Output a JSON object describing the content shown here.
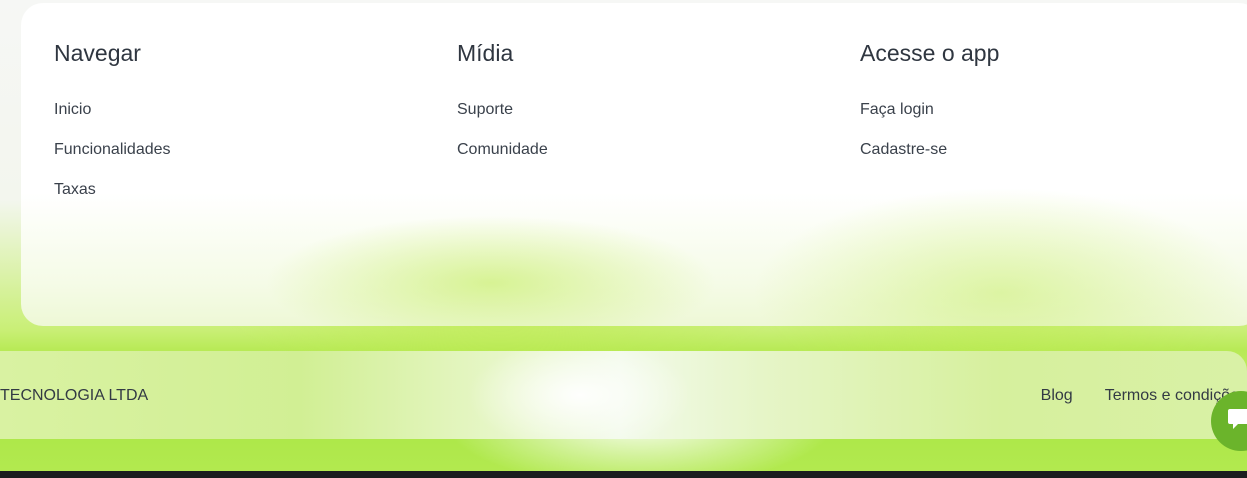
{
  "footer": {
    "columns": [
      {
        "title": "Navegar",
        "links": [
          "Inicio",
          "Funcionalidades",
          "Taxas"
        ]
      },
      {
        "title": "Mídia",
        "links": [
          "Suporte",
          "Comunidade"
        ]
      },
      {
        "title": "Acesse o app",
        "links": [
          "Faça login",
          "Cadastre-se"
        ]
      }
    ],
    "bottom": {
      "company": "TECNOLOGIA LTDA",
      "links": [
        "Blog",
        "Termos e condições"
      ]
    }
  },
  "chat": {
    "icon": "chat-bubble-icon"
  },
  "colors": {
    "accent": "#b2e94f",
    "chat": "#6bb42b",
    "text": "#333a44"
  }
}
